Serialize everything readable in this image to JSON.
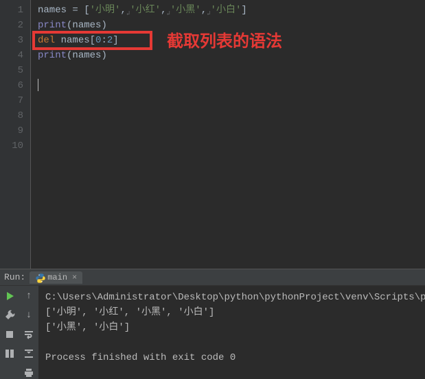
{
  "line_numbers": [
    "1",
    "2",
    "3",
    "4",
    "5",
    "6",
    "7",
    "8",
    "9",
    "10"
  ],
  "code": {
    "line1": {
      "ident": "names",
      "eq": " = [",
      "s1": "'小明'",
      "s2": "'小红'",
      "s3": "'小黑'",
      "s4": "'小白'",
      "close": "]",
      "comma": ",",
      "marker": "↲"
    },
    "line2": {
      "builtin": "print",
      "open": "(",
      "arg": "names",
      "close": ")"
    },
    "line3": {
      "kw": "del",
      "sp": " ",
      "ident": "names",
      "open": "[",
      "n0": "0",
      "colon": ":",
      "n2": "2",
      "close": "]"
    },
    "line4": {
      "builtin": "print",
      "open": "(",
      "arg": "names",
      "close": ")"
    }
  },
  "annotation": "截取列表的语法",
  "run": {
    "label": "Run:",
    "tab": "main"
  },
  "console": {
    "path": "C:\\Users\\Administrator\\Desktop\\python\\pythonProject\\venv\\Scripts\\pyth",
    "out1": "['小明', '小红', '小黑', '小白']",
    "out2": "['小黑', '小白']",
    "blank": "",
    "exit": "Process finished with exit code 0"
  }
}
